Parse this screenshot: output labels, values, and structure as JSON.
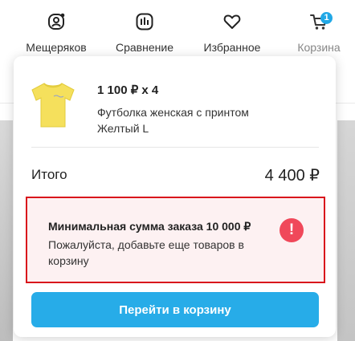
{
  "nav": {
    "items": [
      {
        "label": "Мещеряков",
        "icon": "profile-icon"
      },
      {
        "label": "Сравнение",
        "icon": "compare-icon"
      },
      {
        "label": "Избранное",
        "icon": "heart-icon"
      },
      {
        "label": "Корзина",
        "icon": "cart-icon"
      }
    ],
    "cart_badge": "1"
  },
  "cart_popup": {
    "product": {
      "price_qty": "1 100 ₽  x 4",
      "name": "Футболка женская с принтом",
      "variant": "Желтый L",
      "image_icon": "yellow-tshirt"
    },
    "total": {
      "label": "Итого",
      "value": "4 400 ₽"
    },
    "alert": {
      "title": "Минимальная сумма заказа 10 000 ₽",
      "text": "Пожалуйста, добавьте еще товаров в корзину",
      "icon": "exclamation-icon"
    },
    "checkout_button": "Перейти в корзину"
  },
  "colors": {
    "accent": "#27ace8",
    "alert_border": "#d9161c",
    "alert_bg": "#fdf1f2",
    "alert_icon": "#f0485a"
  }
}
